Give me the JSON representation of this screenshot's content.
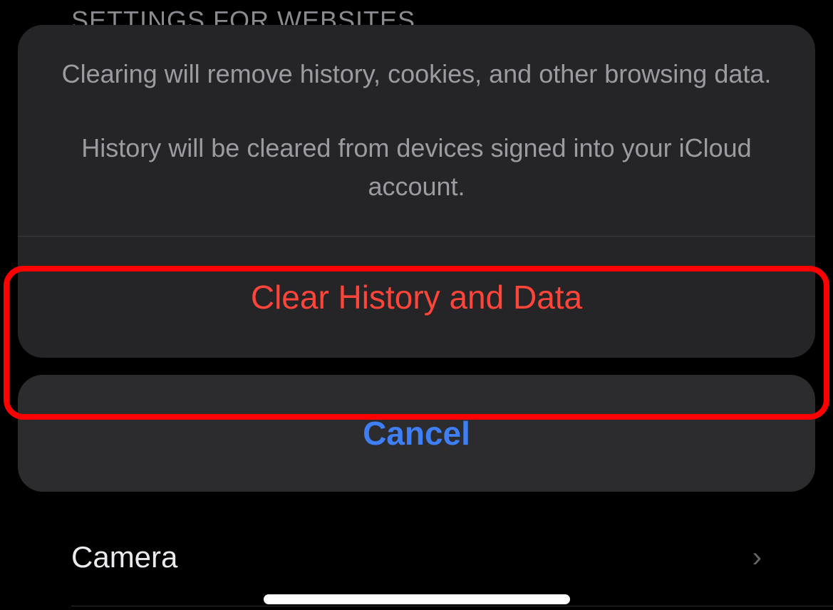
{
  "background": {
    "section_header": "SETTINGS FOR WEBSITES",
    "camera_label": "Camera"
  },
  "sheet": {
    "message_line1": "Clearing will remove history, cookies, and other browsing data.",
    "message_line2": "History will be cleared from devices signed into your iCloud account.",
    "clear_button": "Clear History and Data",
    "cancel_button": "Cancel"
  }
}
